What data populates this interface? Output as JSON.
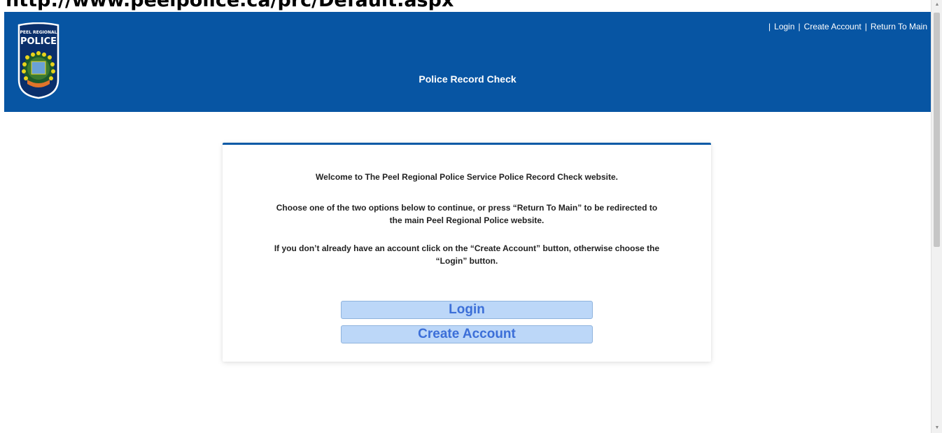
{
  "address_bar": {
    "text": "http://www.peelpolice.ca/prc/Default.aspx"
  },
  "header": {
    "background": "#0755a3",
    "title": "Police Record Check",
    "logo": {
      "line1": "PEEL REGIONAL",
      "line2": "POLICE"
    },
    "links": [
      {
        "label": "Login"
      },
      {
        "label": "Create Account"
      },
      {
        "label": "Return To Main"
      }
    ],
    "separator": "|"
  },
  "panel": {
    "accent": "#0b5aa6",
    "message_1": "Welcome to The Peel Regional Police Service Police Record Check website.",
    "message_2_line1": "Choose one of the two options below to continue, or press “Return To Main” to be redirected to",
    "message_2_line2": "the main Peel Regional Police website.",
    "message_3_line1": "If you don’t already have an account click on the “Create Account” button, otherwise choose the",
    "message_3_line2": "“Login” button.",
    "buttons": {
      "login": "Login",
      "create_account": "Create Account"
    }
  }
}
